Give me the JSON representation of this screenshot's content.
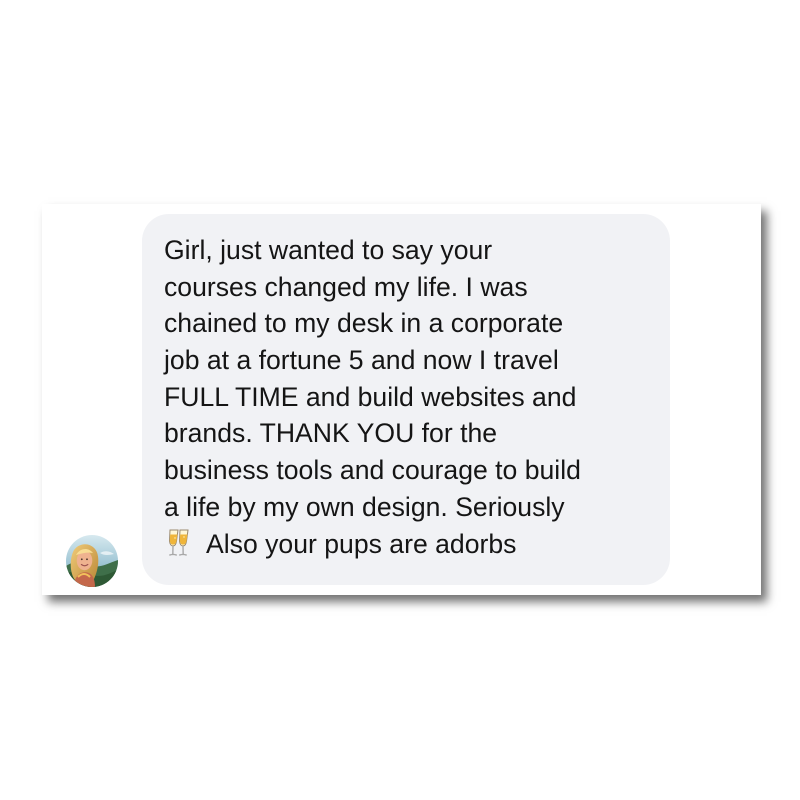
{
  "conversation": {
    "message": {
      "lines": [
        "Girl, just wanted to say your",
        "courses changed my life. I was",
        "chained to my desk in a corporate",
        "job at a fortune 5 and now I travel",
        "FULL TIME and build websites and",
        "brands. THANK YOU for the",
        "business tools and courage to build",
        "a life by my own design. Seriously",
        "Also your pups are adorbs"
      ],
      "emoji_icon": "clinking-glasses-icon"
    },
    "sender": {
      "avatar_icon": "avatar"
    }
  },
  "colors": {
    "page_background": "#ffffff",
    "bubble_background": "#f1f2f5",
    "text": "#151515"
  }
}
